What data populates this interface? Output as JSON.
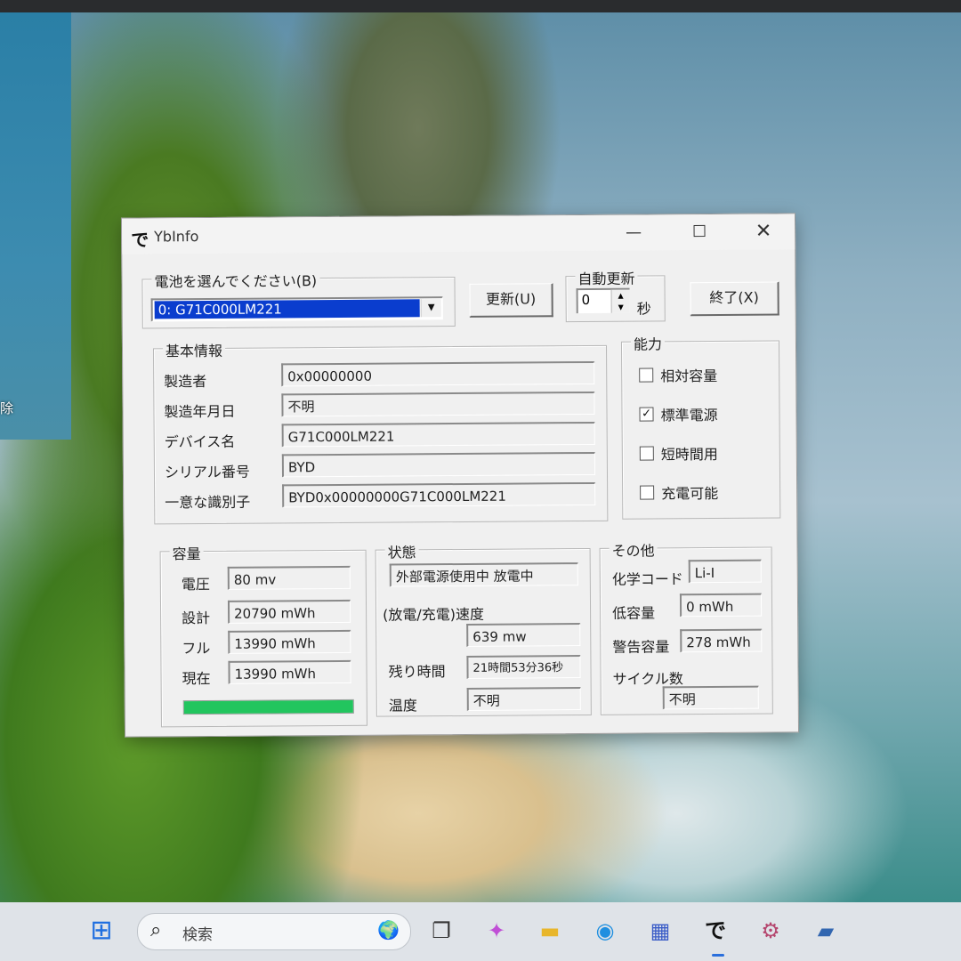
{
  "desktop": {
    "partial_label": "除"
  },
  "window": {
    "title": "YbInfo",
    "app_icon_glyph": "で",
    "controls": {
      "minimize": "—",
      "maximize": "☐",
      "close": "✕"
    }
  },
  "battery_select": {
    "label": "電池を選んでください(B)",
    "selected": "0: G71C000LM221"
  },
  "refresh_button": "更新(U)",
  "auto_update": {
    "label": "自動更新",
    "value": "0",
    "unit": "秒"
  },
  "exit_button": "終了(X)",
  "basic_info": {
    "label": "基本情報",
    "rows": [
      {
        "label": "製造者",
        "value": "0x00000000"
      },
      {
        "label": "製造年月日",
        "value": "不明"
      },
      {
        "label": "デバイス名",
        "value": "G71C000LM221"
      },
      {
        "label": "シリアル番号",
        "value": "BYD"
      },
      {
        "label": "一意な識別子",
        "value": "BYD0x00000000G71C000LM221"
      }
    ]
  },
  "capability": {
    "label": "能力",
    "items": [
      {
        "label": "相対容量",
        "checked": false,
        "mark": ""
      },
      {
        "label": "標準電源",
        "checked": true,
        "mark": "✓"
      },
      {
        "label": "短時間用",
        "checked": false,
        "mark": ""
      },
      {
        "label": "充電可能",
        "checked": false,
        "mark": ""
      }
    ]
  },
  "capacity": {
    "label": "容量",
    "rows": [
      {
        "label": "電圧",
        "value": "80 mv"
      },
      {
        "label": "設計",
        "value": "20790 mWh"
      },
      {
        "label": "フル",
        "value": "13990 mWh"
      },
      {
        "label": "現在",
        "value": "13990 mWh"
      }
    ],
    "charge_fraction": 1.0,
    "bar_color": "#22c55e"
  },
  "status": {
    "label": "状態",
    "state": "外部電源使用中 放電中",
    "rate_label": "(放電/充電)速度",
    "rate": "639 mw",
    "remaining_label": "残り時間",
    "remaining": "21時間53分36秒",
    "temp_label": "温度",
    "temp": "不明"
  },
  "other": {
    "label": "その他",
    "chem_label": "化学コード",
    "chem": "Li-I",
    "low_label": "低容量",
    "low": "0 mWh",
    "warn_label": "警告容量",
    "warn": "278 mWh",
    "cycle_label": "サイクル数",
    "cycle": "不明"
  },
  "taskbar": {
    "search_placeholder": "検索",
    "icons": {
      "start": "⊞",
      "search": "⌕",
      "search_art": "🌍",
      "taskview": "❐",
      "copilot": "✦",
      "files": "▬",
      "edge": "◉",
      "store": "▦",
      "ybinfo": "で",
      "settings": "⚙",
      "other": "▰"
    }
  }
}
